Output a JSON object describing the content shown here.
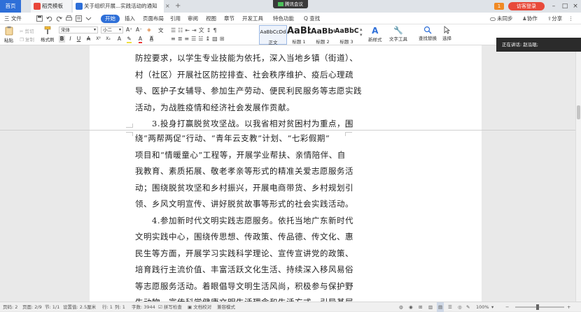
{
  "tabs": {
    "home": "首页",
    "template": "稻壳模板",
    "document": "关于组织开展...实践活动的通知",
    "close": "×",
    "add": "+"
  },
  "meeting_badge": "腾讯会议",
  "title_right": {
    "count": "1",
    "login": "访客登录"
  },
  "menu": {
    "file": "三 文件",
    "items": [
      "开始",
      "插入",
      "页面布局",
      "引用",
      "审阅",
      "视图",
      "章节",
      "开发工具",
      "特色功能"
    ],
    "search": "Q 查找",
    "sync": "未同步",
    "collab": "协作",
    "share": "分享"
  },
  "ribbon": {
    "paste": "粘贴",
    "cut": "剪切",
    "copy": "复制",
    "format_painter": "格式刷",
    "font_name": "宋体",
    "font_size": "小二",
    "styles": [
      {
        "sample": "AaBbCcDd",
        "label": "正文"
      },
      {
        "sample": "AaBb",
        "label": "标题 1"
      },
      {
        "sample": "AaBbC",
        "label": "标题 2"
      },
      {
        "sample": "AaBbC",
        "label": "标题 3"
      }
    ],
    "new_style": "新样式",
    "text_tools": "文字工具",
    "find_replace": "查找替换",
    "select": "选择"
  },
  "meeting_popup": "正在讲话: 赵泓琨;",
  "document": {
    "top_lines": [
      "防控要求，以学生专业技能为依托，深入当地乡镇（街道）、",
      "村（社区）开展社区防控排查、社会秩序维护、疫后心理疏",
      "导、医护子女辅导、参加生产劳动、便民利民服务等志愿实践",
      "活动，为战胜疫情和经济社会发展作贡献。",
      "　　3.投身打赢脱贫攻坚战。以我省相对贫困村为重点，围"
    ],
    "bottom_lines": [
      "绕“两帮两促”行动、“青年云支教”计划、“七彩假期”",
      "项目和“情暖童心”工程等，开展学业帮扶、亲情陪伴、自",
      "我教育、素质拓展、敬老孝亲等形式的精准关爱志愿服务活",
      "动；围绕脱贫攻坚和乡村振兴，开展电商带货、乡村规划引",
      "领、乡风文明宣传、讲好脱贫故事等形式的社会实践活动。",
      "　　4.参加新时代文明实践志愿服务。依托当地广东新时代",
      "文明实践中心，围绕传思想、传政策、传品德、传文化、惠",
      "民生等方面，开展学习实践科学理论、宣传宣讲党的政策、",
      "培育践行主流价值、丰富活跃文化生活、持续深入移风易俗",
      "等志愿服务活动。着眼倡导文明生活风尚，积极参与保护野",
      "生动物、宣传科学健康文明生活理念和生活方式，引导基层"
    ]
  },
  "status": {
    "page_num": "页码: 2",
    "pages": "页面: 2/9",
    "section": "节: 1/1",
    "setting": "设置值: 2.5厘米",
    "row": "行: 1",
    "col": "列: 1",
    "words": "字数: 3944",
    "spell": "拼写检查",
    "proof": "文档校对",
    "compat": "兼容模式",
    "zoom": "100%"
  },
  "colors": {
    "accent": "#2e6fd8",
    "login": "#e84a3a",
    "tab_bar": "#dfe3e8"
  }
}
